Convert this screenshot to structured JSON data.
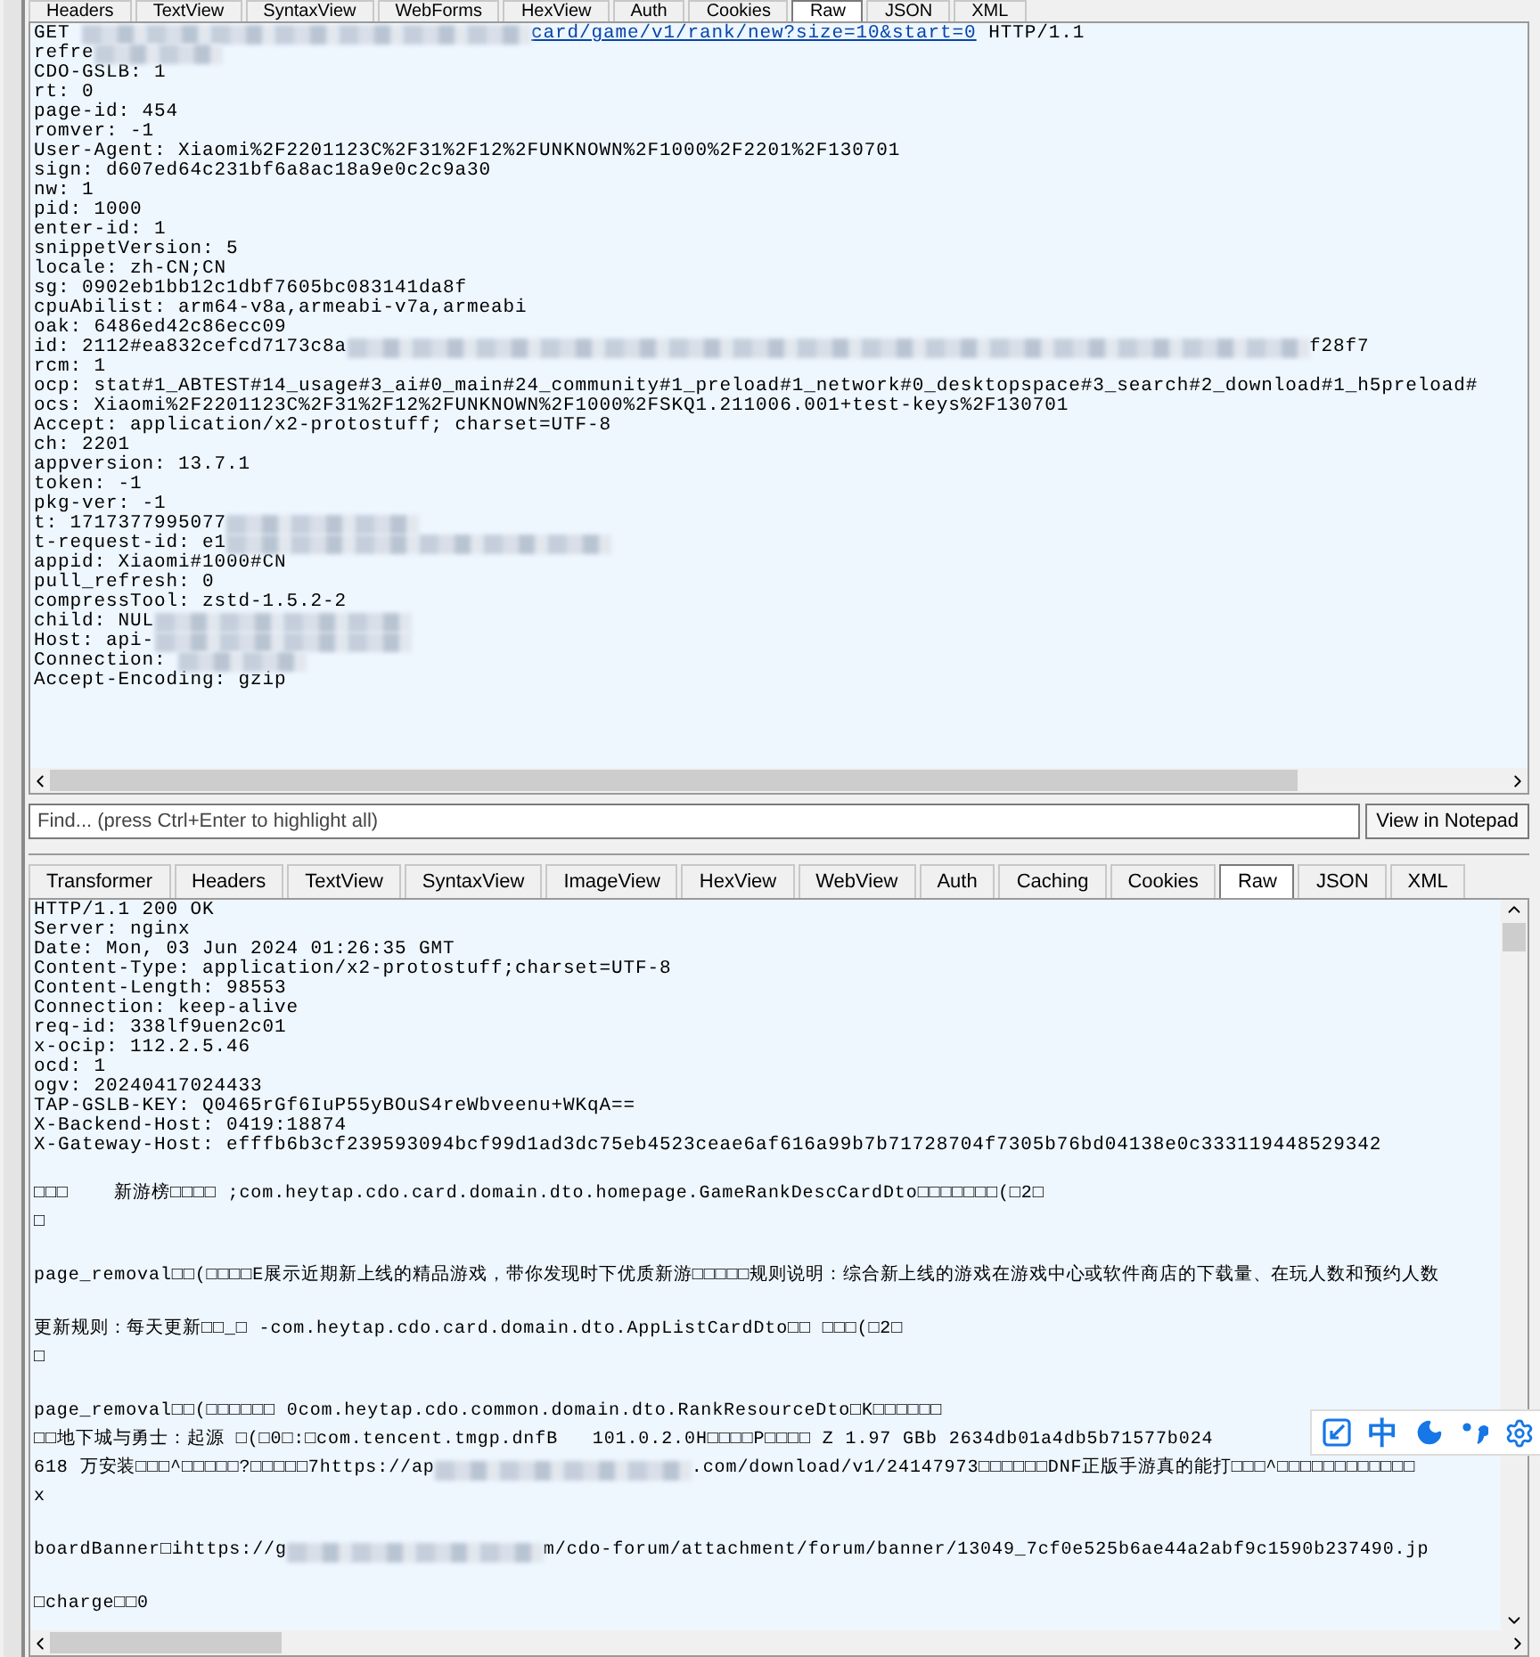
{
  "request_panel": {
    "tabs": [
      {
        "label": "Headers",
        "selected": false
      },
      {
        "label": "TextView",
        "selected": false
      },
      {
        "label": "SyntaxView",
        "selected": false
      },
      {
        "label": "WebForms",
        "selected": false
      },
      {
        "label": "HexView",
        "selected": false
      },
      {
        "label": "Auth",
        "selected": false
      },
      {
        "label": "Cookies",
        "selected": false
      },
      {
        "label": "Raw",
        "selected": true
      },
      {
        "label": "JSON",
        "selected": false
      },
      {
        "label": "XML",
        "selected": false
      }
    ],
    "lines": [
      {
        "segments": [
          {
            "kind": "text",
            "text": "GET "
          },
          {
            "kind": "blur"
          },
          {
            "kind": "blur"
          },
          {
            "kind": "blur"
          },
          {
            "kind": "blur"
          },
          {
            "kind": "blur"
          },
          {
            "kind": "blur"
          },
          {
            "kind": "blur"
          },
          {
            "kind": "link",
            "text": "card/game/v1/rank/new?size=10&start=0"
          },
          {
            "kind": "text",
            "text": " HTTP/1.1"
          }
        ]
      },
      {
        "segments": [
          {
            "kind": "text",
            "text": "refre"
          },
          {
            "kind": "blur"
          },
          {
            "kind": "blur"
          }
        ]
      },
      {
        "text": "CDO-GSLB: 1"
      },
      {
        "text": "rt: 0"
      },
      {
        "text": "page-id: 454"
      },
      {
        "text": "romver: -1"
      },
      {
        "text": "User-Agent: Xiaomi%2F2201123C%2F31%2F12%2FUNKNOWN%2F1000%2F2201%2F130701"
      },
      {
        "text": "sign: d607ed64c231bf6a8ac18a9e0c2c9a30"
      },
      {
        "text": "nw: 1"
      },
      {
        "text": "pid: 1000"
      },
      {
        "text": "enter-id: 1"
      },
      {
        "text": "snippetVersion: 5"
      },
      {
        "text": "locale: zh-CN;CN"
      },
      {
        "text": "sg: 0902eb1bb12c1dbf7605bc083141da8f"
      },
      {
        "text": "cpuAbilist: arm64-v8a,armeabi-v7a,armeabi"
      },
      {
        "text": "oak: 6486ed42c86ecc09"
      },
      {
        "segments": [
          {
            "kind": "text",
            "text": "id: 2112#ea832cefcd7173c8a"
          },
          {
            "kind": "blur"
          },
          {
            "kind": "blur"
          },
          {
            "kind": "blur"
          },
          {
            "kind": "blur"
          },
          {
            "kind": "blur"
          },
          {
            "kind": "blur"
          },
          {
            "kind": "blur"
          },
          {
            "kind": "blur"
          },
          {
            "kind": "blur"
          },
          {
            "kind": "blur"
          },
          {
            "kind": "blur"
          },
          {
            "kind": "blur"
          },
          {
            "kind": "blur"
          },
          {
            "kind": "blur"
          },
          {
            "kind": "blur"
          },
          {
            "kind": "text",
            "text": "f28f7"
          }
        ]
      },
      {
        "text": "rcm: 1"
      },
      {
        "text": "ocp: stat#1_ABTEST#14_usage#3_ai#0_main#24_community#1_preload#1_network#0_desktopspace#3_search#2_download#1_h5preload#"
      },
      {
        "text": "ocs: Xiaomi%2F2201123C%2F31%2F12%2FUNKNOWN%2F1000%2FSKQ1.211006.001+test-keys%2F130701"
      },
      {
        "text": "Accept: application/x2-protostuff; charset=UTF-8"
      },
      {
        "text": "ch: 2201"
      },
      {
        "text": "appversion: 13.7.1"
      },
      {
        "text": "token: -1"
      },
      {
        "text": "pkg-ver: -1"
      },
      {
        "segments": [
          {
            "kind": "text",
            "text": "t: 1717377995077"
          },
          {
            "kind": "blur"
          },
          {
            "kind": "blur"
          },
          {
            "kind": "blur"
          }
        ]
      },
      {
        "segments": [
          {
            "kind": "text",
            "text": "t-request-id: e1"
          },
          {
            "kind": "blur"
          },
          {
            "kind": "blur"
          },
          {
            "kind": "blur"
          },
          {
            "kind": "blur"
          },
          {
            "kind": "blur"
          },
          {
            "kind": "blur"
          }
        ]
      },
      {
        "text": "appid: Xiaomi#1000#CN"
      },
      {
        "text": "pull_refresh: 0"
      },
      {
        "text": "compressTool: zstd-1.5.2-2"
      },
      {
        "segments": [
          {
            "kind": "text",
            "text": "child: NUL"
          },
          {
            "kind": "blur"
          },
          {
            "kind": "blur"
          },
          {
            "kind": "blur"
          },
          {
            "kind": "blur"
          }
        ]
      },
      {
        "segments": [
          {
            "kind": "text",
            "text": "Host: api-"
          },
          {
            "kind": "blur"
          },
          {
            "kind": "blur"
          },
          {
            "kind": "blur"
          },
          {
            "kind": "blur"
          }
        ]
      },
      {
        "segments": [
          {
            "kind": "text",
            "text": "Connection: "
          },
          {
            "kind": "blur"
          },
          {
            "kind": "blur"
          }
        ]
      },
      {
        "text": "Accept-Encoding: gzip"
      }
    ],
    "find_placeholder": "Find... (press Ctrl+Enter to highlight all)",
    "notepad_button": "View in Notepad"
  },
  "response_panel": {
    "tabs": [
      {
        "label": "Transformer",
        "selected": false
      },
      {
        "label": "Headers",
        "selected": false
      },
      {
        "label": "TextView",
        "selected": false
      },
      {
        "label": "SyntaxView",
        "selected": false
      },
      {
        "label": "ImageView",
        "selected": false
      },
      {
        "label": "HexView",
        "selected": false
      },
      {
        "label": "WebView",
        "selected": false
      },
      {
        "label": "Auth",
        "selected": false
      },
      {
        "label": "Caching",
        "selected": false
      },
      {
        "label": "Cookies",
        "selected": false
      },
      {
        "label": "Raw",
        "selected": true
      },
      {
        "label": "JSON",
        "selected": false
      },
      {
        "label": "XML",
        "selected": false
      }
    ],
    "lines": [
      {
        "text": "HTTP/1.1 200 OK"
      },
      {
        "text": "Server: nginx"
      },
      {
        "text": "Date: Mon, 03 Jun 2024 01:26:35 GMT"
      },
      {
        "text": "Content-Type: application/x2-protostuff;charset=UTF-8"
      },
      {
        "text": "Content-Length: 98553"
      },
      {
        "text": "Connection: keep-alive"
      },
      {
        "text": "req-id: 338lf9uen2c01"
      },
      {
        "text": "x-ocip: 112.2.5.46"
      },
      {
        "text": "ocd: 1"
      },
      {
        "text": "ogv: 20240417024433"
      },
      {
        "text": "TAP-GSLB-KEY: Q0465rGf6IuP55yBOuS4reWbveenu+WKqA=="
      },
      {
        "text": "X-Backend-Host: 0419:18874"
      },
      {
        "text": "X-Gateway-Host: efffb6b3cf239593094bcf99d1ad3dc75eb4523ceae6af616a99b7b71728704f7305b76bd04138e0c333119448529342"
      },
      {
        "text": "□□□    新游榜□□□□ ;com.heytap.cdo.card.domain.dto.homepage.GameRankDescCardDto□□□□□□□(□2□",
        "spaced": true
      },
      {
        "text": "□"
      },
      {
        "text": "page_removal□□(□□□□E展示近期新上线的精品游戏，带你发现时下优质新游□□□□□规则说明：综合新上线的游戏在游戏中心或软件商店的下载量、在玩人数和预约人数",
        "spaced": true
      },
      {
        "text": "更新规则：每天更新□□_□ -com.heytap.cdo.card.domain.dto.AppListCardDto□□ □□□(□2□",
        "spaced": true
      },
      {
        "text": "□"
      },
      {
        "text": "page_removal□□(□□□□□□ 0com.heytap.cdo.common.domain.dto.RankResourceDto□K□□□□□□",
        "spaced": true
      },
      {
        "text": "□□地下城与勇士：起源 □(□0□:□com.tencent.tmgp.dnfB   101.0.2.0H□□□□P□□□□ Z 1.97 GBb 2634db01a4db5b71577b024"
      },
      {
        "segments": [
          {
            "kind": "text",
            "text": "618 万安装□□□^□□□□□?□□□□□7https://ap"
          },
          {
            "kind": "blur"
          },
          {
            "kind": "blur"
          },
          {
            "kind": "blur"
          },
          {
            "kind": "blur"
          },
          {
            "kind": "text",
            "text": ".com/download/v1/24147973□□□□□□DNF正版手游真的能打□□□^□□□□□□□□□□□□"
          }
        ]
      },
      {
        "text": "x"
      },
      {
        "spaced": true,
        "segments": [
          {
            "kind": "text",
            "text": "boardBanner□ihttps://g"
          },
          {
            "kind": "blur"
          },
          {
            "kind": "blur"
          },
          {
            "kind": "blur"
          },
          {
            "kind": "blur"
          },
          {
            "kind": "text",
            "text": "m/cdo-forum/attachment/forum/banner/13049_7cf0e525b6ae44a2abf9c1590b237490.jp"
          }
        ]
      },
      {
        "text": "□charge□□0",
        "spaced": true
      }
    ]
  },
  "ime_toolbar": {
    "label": "中"
  }
}
